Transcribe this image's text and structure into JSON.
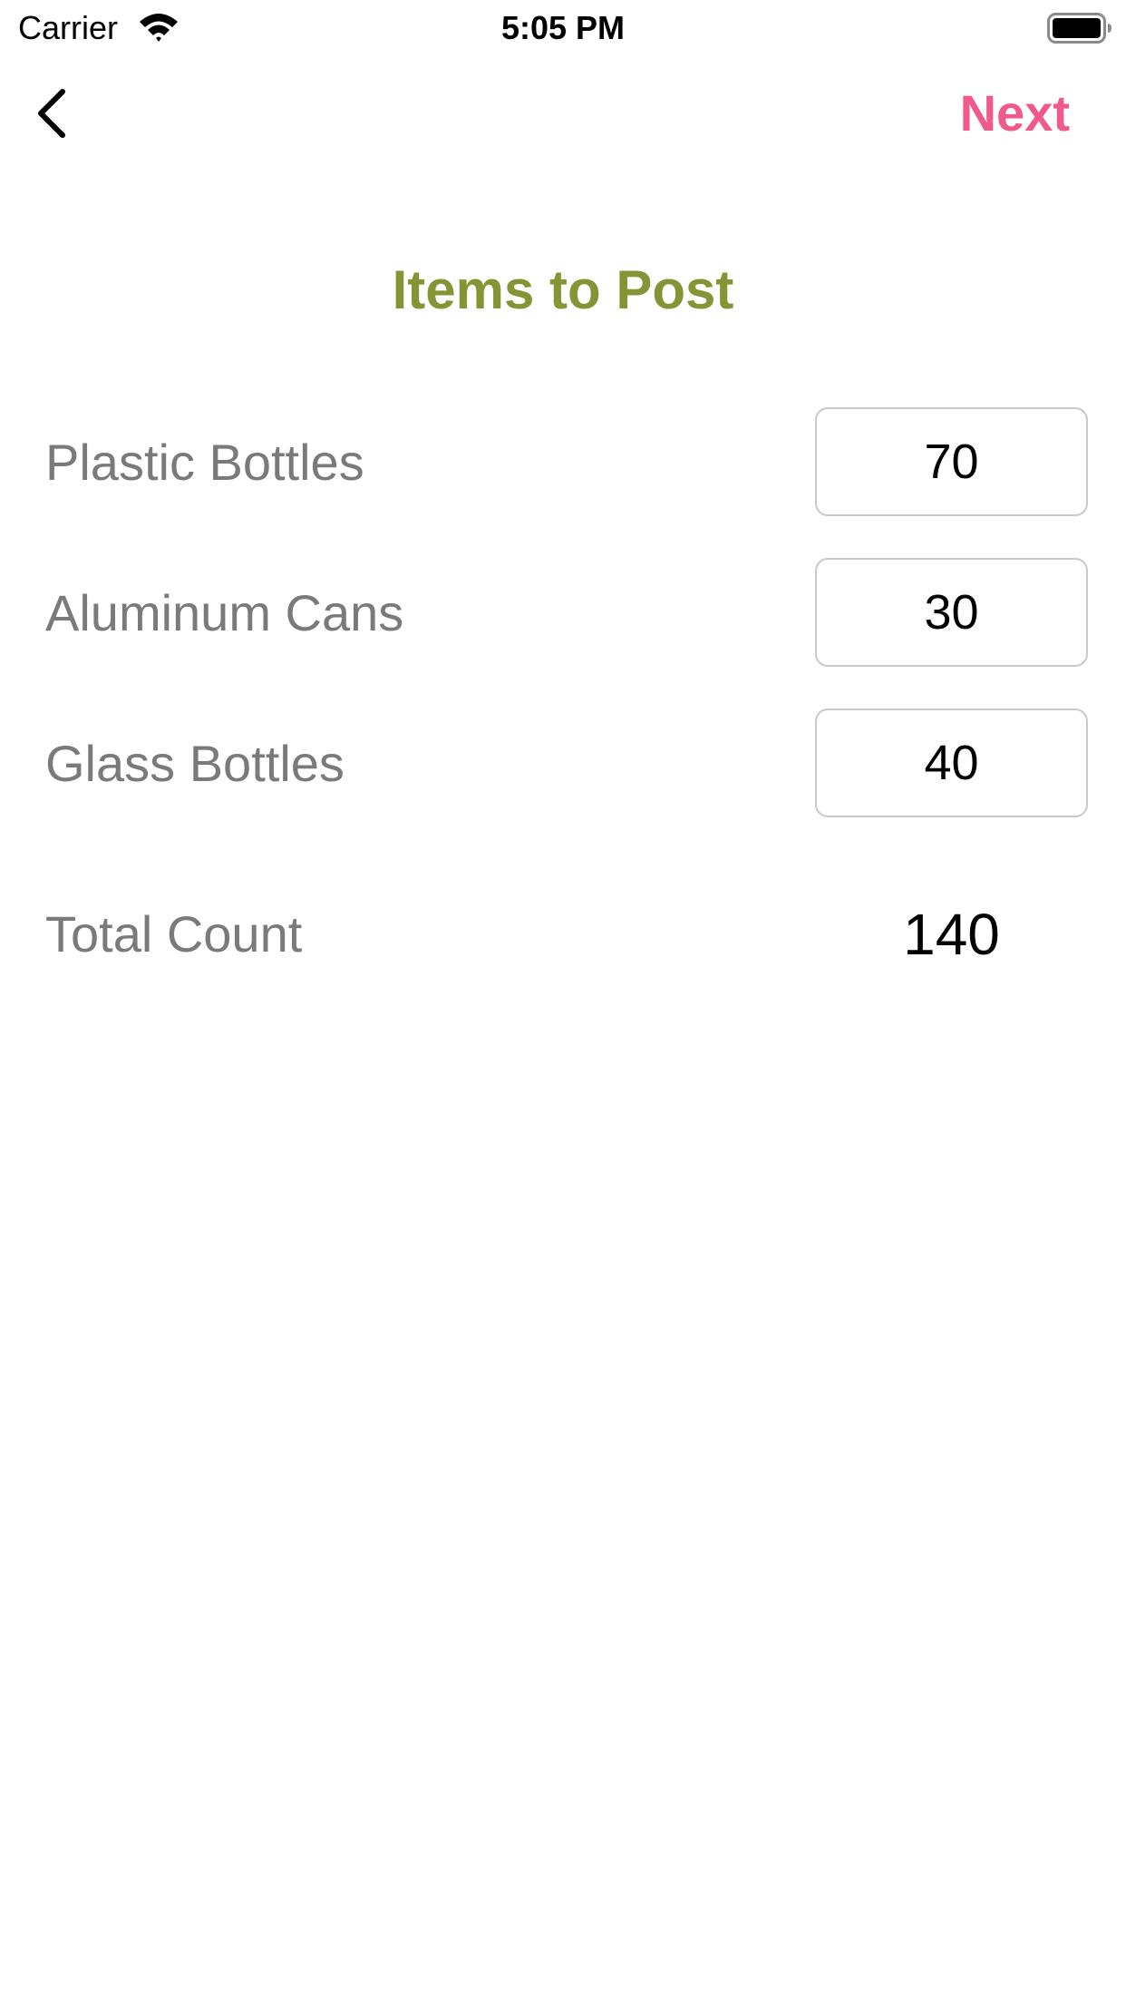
{
  "status_bar": {
    "carrier": "Carrier",
    "time": "5:05 PM",
    "wifi_icon": "wifi-icon",
    "battery_icon": "battery-icon"
  },
  "nav": {
    "back_icon": "chevron-left-icon",
    "next_label": "Next",
    "next_color": "#ef5a8a"
  },
  "title": {
    "text": "Items to Post",
    "color": "#859434"
  },
  "items": [
    {
      "label": "Plastic Bottles",
      "value": "70"
    },
    {
      "label": "Aluminum Cans",
      "value": "30"
    },
    {
      "label": "Glass Bottles",
      "value": "40"
    }
  ],
  "total": {
    "label": "Total Count",
    "value": "140"
  }
}
